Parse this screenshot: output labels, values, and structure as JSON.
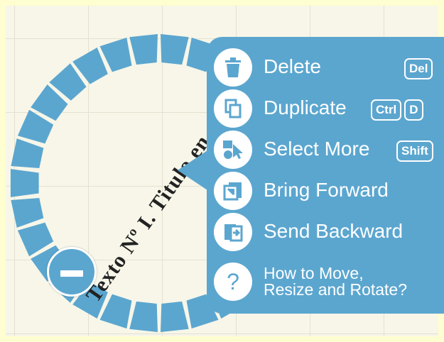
{
  "shape": {
    "arc_text": "Texto Nº I. Titulo en"
  },
  "menu": {
    "items": [
      {
        "label": "Delete",
        "keys": [
          "Del"
        ],
        "icon": "trash-can-icon"
      },
      {
        "label": "Duplicate",
        "keys": [
          "Ctrl",
          "D"
        ],
        "icon": "duplicate-icon"
      },
      {
        "label": "Select More",
        "keys": [
          "Shift"
        ],
        "icon": "select-more-icon"
      },
      {
        "label": "Bring Forward",
        "keys": [],
        "icon": "bring-forward-icon"
      },
      {
        "label": "Send Backward",
        "keys": [],
        "icon": "send-backward-icon"
      },
      {
        "label": "How to Move,\nResize and Rotate?",
        "keys": [],
        "icon": "question-mark-icon"
      }
    ]
  },
  "colors": {
    "accent": "#5ba6cf",
    "page_background": "#fffed0",
    "canvas": "#f7f6e9",
    "arc_text": "#222222"
  }
}
